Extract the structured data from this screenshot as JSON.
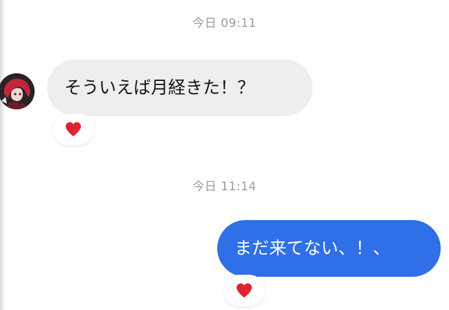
{
  "conversation": {
    "groups": [
      {
        "timestamp": "今日 09:11",
        "message": {
          "direction": "incoming",
          "text": "そういえば月経きた！？",
          "reaction_icon": "heart-icon"
        }
      },
      {
        "timestamp": "今日 11:14",
        "message": {
          "direction": "outgoing",
          "text": "まだ来てない、！、",
          "reaction_icon": "heart-icon"
        }
      }
    ]
  },
  "colors": {
    "incoming_bubble": "#eeeef0",
    "outgoing_bubble": "#2f6fe8",
    "timestamp_text": "#9a9a9a",
    "heart": "#e02233"
  }
}
